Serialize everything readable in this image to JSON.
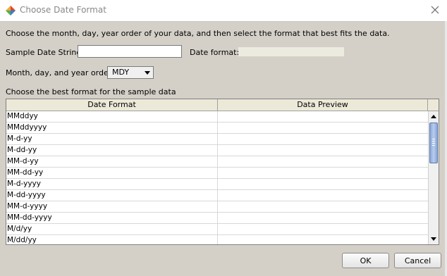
{
  "window": {
    "title": "Choose Date Format",
    "icon": "app-logo-icon",
    "close_icon": "close-icon"
  },
  "instructions": "Choose the month, day, year order of your data, and then select the format that best fits the data.",
  "sample": {
    "label": "Sample Date String:",
    "value": "",
    "placeholder": ""
  },
  "date_format": {
    "label": "Date format:",
    "value": ""
  },
  "order": {
    "label": "Month, day, and year order:",
    "selected": "MDY"
  },
  "table": {
    "caption": "Choose the best format for the sample data",
    "headers": [
      "Date Format",
      "Data Preview"
    ],
    "rows": [
      {
        "format": "MMddyy",
        "preview": ""
      },
      {
        "format": "MMddyyyy",
        "preview": ""
      },
      {
        "format": "M-d-yy",
        "preview": ""
      },
      {
        "format": "M-dd-yy",
        "preview": ""
      },
      {
        "format": "MM-d-yy",
        "preview": ""
      },
      {
        "format": "MM-dd-yy",
        "preview": ""
      },
      {
        "format": "M-d-yyyy",
        "preview": ""
      },
      {
        "format": "M-dd-yyyy",
        "preview": ""
      },
      {
        "format": "MM-d-yyyy",
        "preview": ""
      },
      {
        "format": "MM-dd-yyyy",
        "preview": ""
      },
      {
        "format": "M/d/yy",
        "preview": ""
      },
      {
        "format": "M/dd/yy",
        "preview": ""
      }
    ]
  },
  "buttons": {
    "ok": "OK",
    "cancel": "Cancel"
  }
}
